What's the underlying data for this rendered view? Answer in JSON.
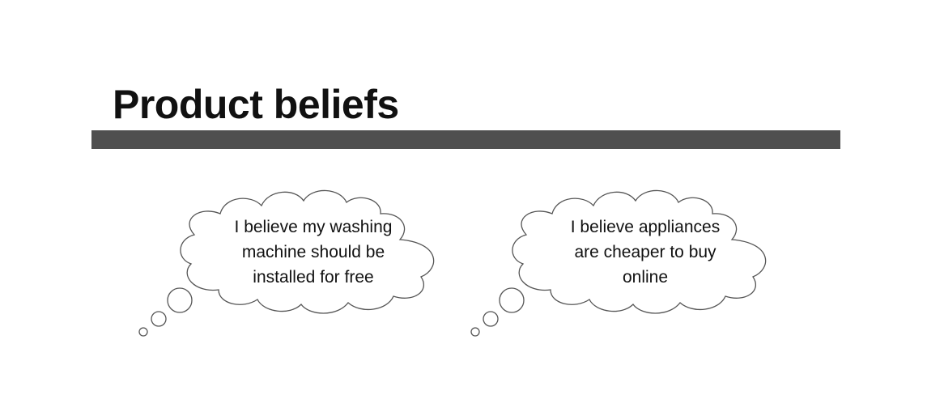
{
  "slide": {
    "title": "Product beliefs"
  },
  "beliefs": [
    {
      "text": "I believe my washing\nmachine  should be\ninstalled for free"
    },
    {
      "text": "I believe appliances\nare cheaper to buy\nonline"
    }
  ],
  "colors": {
    "title_bar": "#4f4f4f",
    "cloud_stroke": "#555555",
    "text": "#111111"
  }
}
